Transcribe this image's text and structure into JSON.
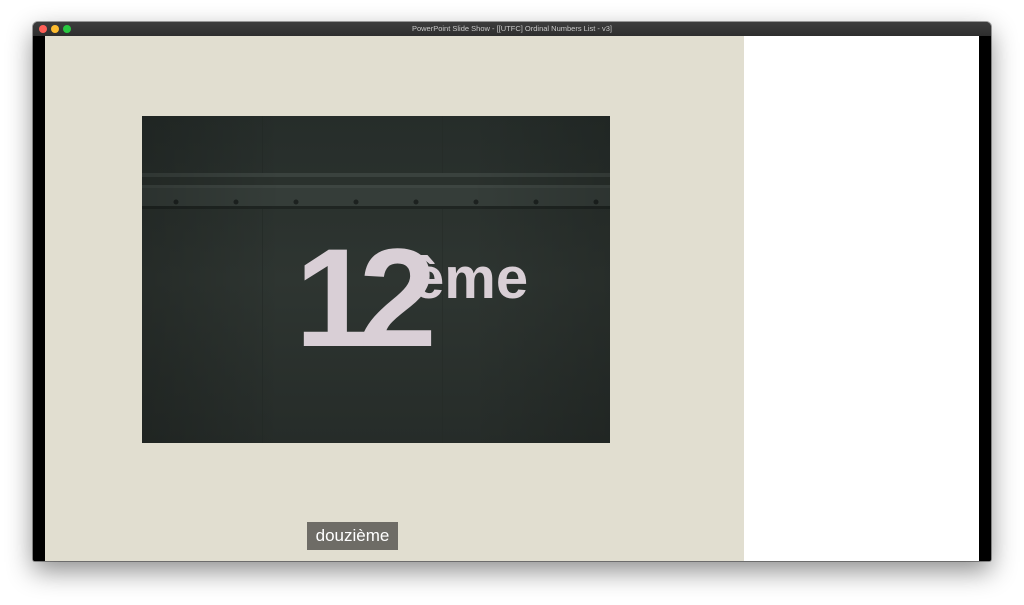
{
  "window": {
    "title": "PowerPoint Slide Show - [[UTFC] Ordinal Numbers List - v3]"
  },
  "slide": {
    "photo": {
      "number_text": "12",
      "suffix_text": "ème"
    },
    "caption": "douzième"
  },
  "colors": {
    "slide_background": "#e1ded0",
    "photo_background": "#2c332f",
    "stencil_text": "#d9cfd6",
    "caption_background": "#6e6c66"
  }
}
